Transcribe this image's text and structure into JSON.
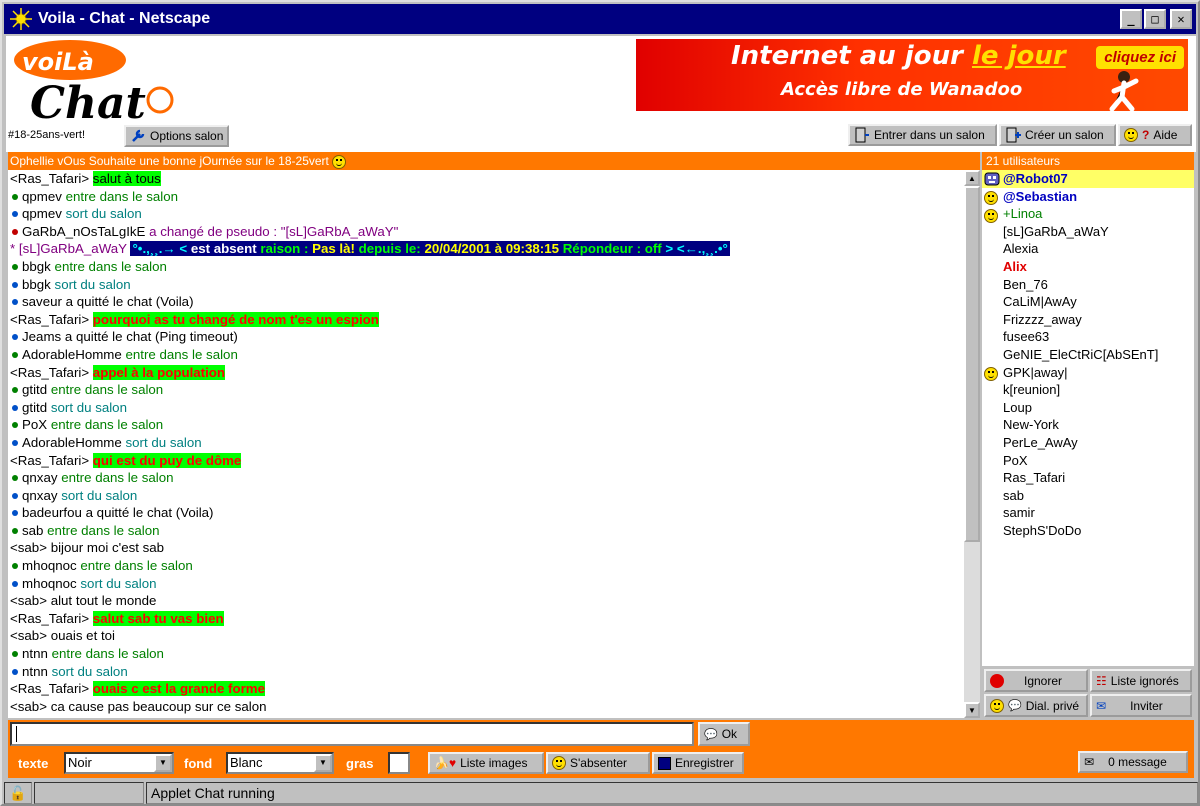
{
  "window": {
    "title": "Voila - Chat - Netscape",
    "controls": {
      "minimize": "_",
      "maximize": "□",
      "close": "✕"
    }
  },
  "logo": {
    "top_text": "voiLà",
    "bottom_text": "Chat"
  },
  "banner": {
    "line1_prefix": "Internet au jour ",
    "line1_highlight": "le jour",
    "line2": "Accès libre de Wanadoo",
    "cta": "cliquez ici"
  },
  "room": {
    "name": "#18-25ans-vert!"
  },
  "toolbar": {
    "options_salon": "Options salon",
    "enter_room": "Entrer dans un salon",
    "create_room": "Créer un salon",
    "help": "Aide"
  },
  "topic": "Ophellie vOus Souhaite une bonne jOurnée sur le 18-25vert",
  "users_count": "21 utilisateurs",
  "chat_lines": [
    {
      "type": "msg",
      "nick": "<Ras_Tafari>",
      "text": "salut à tous",
      "style": "hl"
    },
    {
      "type": "event",
      "dot": "green",
      "nick": "qpmev",
      "text": "entre dans le salon",
      "cls": "c-green"
    },
    {
      "type": "event",
      "dot": "blue",
      "nick": "qpmev",
      "text": "sort du salon",
      "cls": "c-teal"
    },
    {
      "type": "event",
      "dot": "red",
      "nick": "GaRbA_nOsTaLgIkE",
      "text": "a changé de pseudo : \"[sL]GaRbA_aWaY\"",
      "cls": "c-purple"
    },
    {
      "type": "absent",
      "nick": "* [sL]GaRbA_aWaY",
      "text": "est absent",
      "reason_label": "raison :",
      "reason": "Pas là!",
      "since_label": "depuis le:",
      "since": "20/04/2001 à 09:38:15",
      "responder": "Répondeur : off"
    },
    {
      "type": "event",
      "dot": "green",
      "nick": "bbgk",
      "text": "entre dans le salon",
      "cls": "c-green"
    },
    {
      "type": "event",
      "dot": "blue",
      "nick": "bbgk",
      "text": "sort du salon",
      "cls": "c-teal"
    },
    {
      "type": "event",
      "dot": "blue",
      "nick": "saveur",
      "text": "a quitté le chat (Voila)",
      "cls": ""
    },
    {
      "type": "msg",
      "nick": "<Ras_Tafari>",
      "text": "pourquoi as tu changé de nom t'es un espion",
      "style": "hl-red"
    },
    {
      "type": "event",
      "dot": "blue",
      "nick": "Jeams",
      "text": "a quitté le chat (Ping timeout)",
      "cls": ""
    },
    {
      "type": "event",
      "dot": "green",
      "nick": "AdorableHomme",
      "text": "entre dans le salon",
      "cls": "c-green"
    },
    {
      "type": "msg",
      "nick": "<Ras_Tafari>",
      "text": "appel à la population",
      "style": "hl-red"
    },
    {
      "type": "event",
      "dot": "green",
      "nick": "gtitd",
      "text": "entre dans le salon",
      "cls": "c-green"
    },
    {
      "type": "event",
      "dot": "blue",
      "nick": "gtitd",
      "text": "sort du salon",
      "cls": "c-teal"
    },
    {
      "type": "event",
      "dot": "green",
      "nick": "PoX",
      "text": "entre dans le salon",
      "cls": "c-green"
    },
    {
      "type": "event",
      "dot": "blue",
      "nick": "AdorableHomme",
      "text": "sort du salon",
      "cls": "c-teal"
    },
    {
      "type": "msg",
      "nick": "<Ras_Tafari>",
      "text": "qui est du puy de dôme",
      "style": "hl-red"
    },
    {
      "type": "event",
      "dot": "green",
      "nick": "qnxay",
      "text": "entre dans le salon",
      "cls": "c-green"
    },
    {
      "type": "event",
      "dot": "blue",
      "nick": "qnxay",
      "text": "sort du salon",
      "cls": "c-teal"
    },
    {
      "type": "event",
      "dot": "blue",
      "nick": "badeurfou",
      "text": "a quitté le chat (Voila)",
      "cls": ""
    },
    {
      "type": "event",
      "dot": "green",
      "nick": "sab",
      "text": "entre dans le salon",
      "cls": "c-green"
    },
    {
      "type": "msg",
      "nick": "<sab>",
      "text": "bijour moi c'est sab",
      "style": ""
    },
    {
      "type": "event",
      "dot": "green",
      "nick": "mhoqnoc",
      "text": "entre dans le salon",
      "cls": "c-green"
    },
    {
      "type": "event",
      "dot": "blue",
      "nick": "mhoqnoc",
      "text": "sort du salon",
      "cls": "c-teal"
    },
    {
      "type": "msg",
      "nick": "<sab>",
      "text": "alut tout le monde",
      "style": ""
    },
    {
      "type": "msg",
      "nick": "<Ras_Tafari>",
      "text": "salut sab tu vas bien",
      "style": "hl-red"
    },
    {
      "type": "msg",
      "nick": "<sab>",
      "text": "ouais et toi",
      "style": ""
    },
    {
      "type": "event",
      "dot": "green",
      "nick": "ntnn",
      "text": "entre dans le salon",
      "cls": "c-green"
    },
    {
      "type": "event",
      "dot": "blue",
      "nick": "ntnn",
      "text": "sort du salon",
      "cls": "c-teal"
    },
    {
      "type": "msg",
      "nick": "<Ras_Tafari>",
      "text": "ouais c est la grande forme",
      "style": "hl-red"
    },
    {
      "type": "msg",
      "nick": "<sab>",
      "text": "ca cause pas beaucoup sur ce salon",
      "style": ""
    }
  ],
  "users": [
    {
      "name": "@Robot07",
      "cls": "u-op",
      "icon": "robot",
      "selected": true
    },
    {
      "name": "@Sebastian",
      "cls": "u-op",
      "icon": "smile",
      "selected": false
    },
    {
      "name": "+Linoa",
      "cls": "u-voice",
      "icon": "smile",
      "selected": false
    },
    {
      "name": "[sL]GaRbA_aWaY",
      "cls": "",
      "icon": "",
      "selected": false
    },
    {
      "name": "Alexia",
      "cls": "",
      "icon": "",
      "selected": false
    },
    {
      "name": "Alix",
      "cls": "u-red",
      "icon": "",
      "selected": false
    },
    {
      "name": "Ben_76",
      "cls": "",
      "icon": "",
      "selected": false
    },
    {
      "name": "CaLiM|AwAy",
      "cls": "",
      "icon": "",
      "selected": false
    },
    {
      "name": "Frizzzz_away",
      "cls": "",
      "icon": "",
      "selected": false
    },
    {
      "name": "fusee63",
      "cls": "",
      "icon": "",
      "selected": false
    },
    {
      "name": "GeNIE_EleCtRiC[AbSEnT]",
      "cls": "",
      "icon": "",
      "selected": false
    },
    {
      "name": "GPK|away|",
      "cls": "",
      "icon": "smile-away",
      "selected": false
    },
    {
      "name": "k[reunion]",
      "cls": "",
      "icon": "",
      "selected": false
    },
    {
      "name": "Loup",
      "cls": "",
      "icon": "",
      "selected": false
    },
    {
      "name": "New-York",
      "cls": "",
      "icon": "",
      "selected": false
    },
    {
      "name": "PerLe_AwAy",
      "cls": "",
      "icon": "",
      "selected": false
    },
    {
      "name": "PoX",
      "cls": "",
      "icon": "",
      "selected": false
    },
    {
      "name": "Ras_Tafari",
      "cls": "",
      "icon": "",
      "selected": false
    },
    {
      "name": "sab",
      "cls": "",
      "icon": "",
      "selected": false
    },
    {
      "name": "samir",
      "cls": "",
      "icon": "",
      "selected": false
    },
    {
      "name": "StephS'DoDo",
      "cls": "",
      "icon": "",
      "selected": false
    }
  ],
  "user_actions": {
    "ignore": "Ignorer",
    "ignored_list": "Liste ignorés",
    "private_dial": "Dial. privé",
    "invite": "Inviter"
  },
  "input": {
    "value": "",
    "ok": "Ok"
  },
  "options": {
    "text_label": "texte",
    "text_color": "Noir",
    "bg_label": "fond",
    "bg_color": "Blanc",
    "bold_label": "gras",
    "images_list": "Liste images",
    "away": "S'absenter",
    "save": "Enregistrer",
    "messages": "0 message"
  },
  "status": {
    "text": "Applet Chat running"
  }
}
